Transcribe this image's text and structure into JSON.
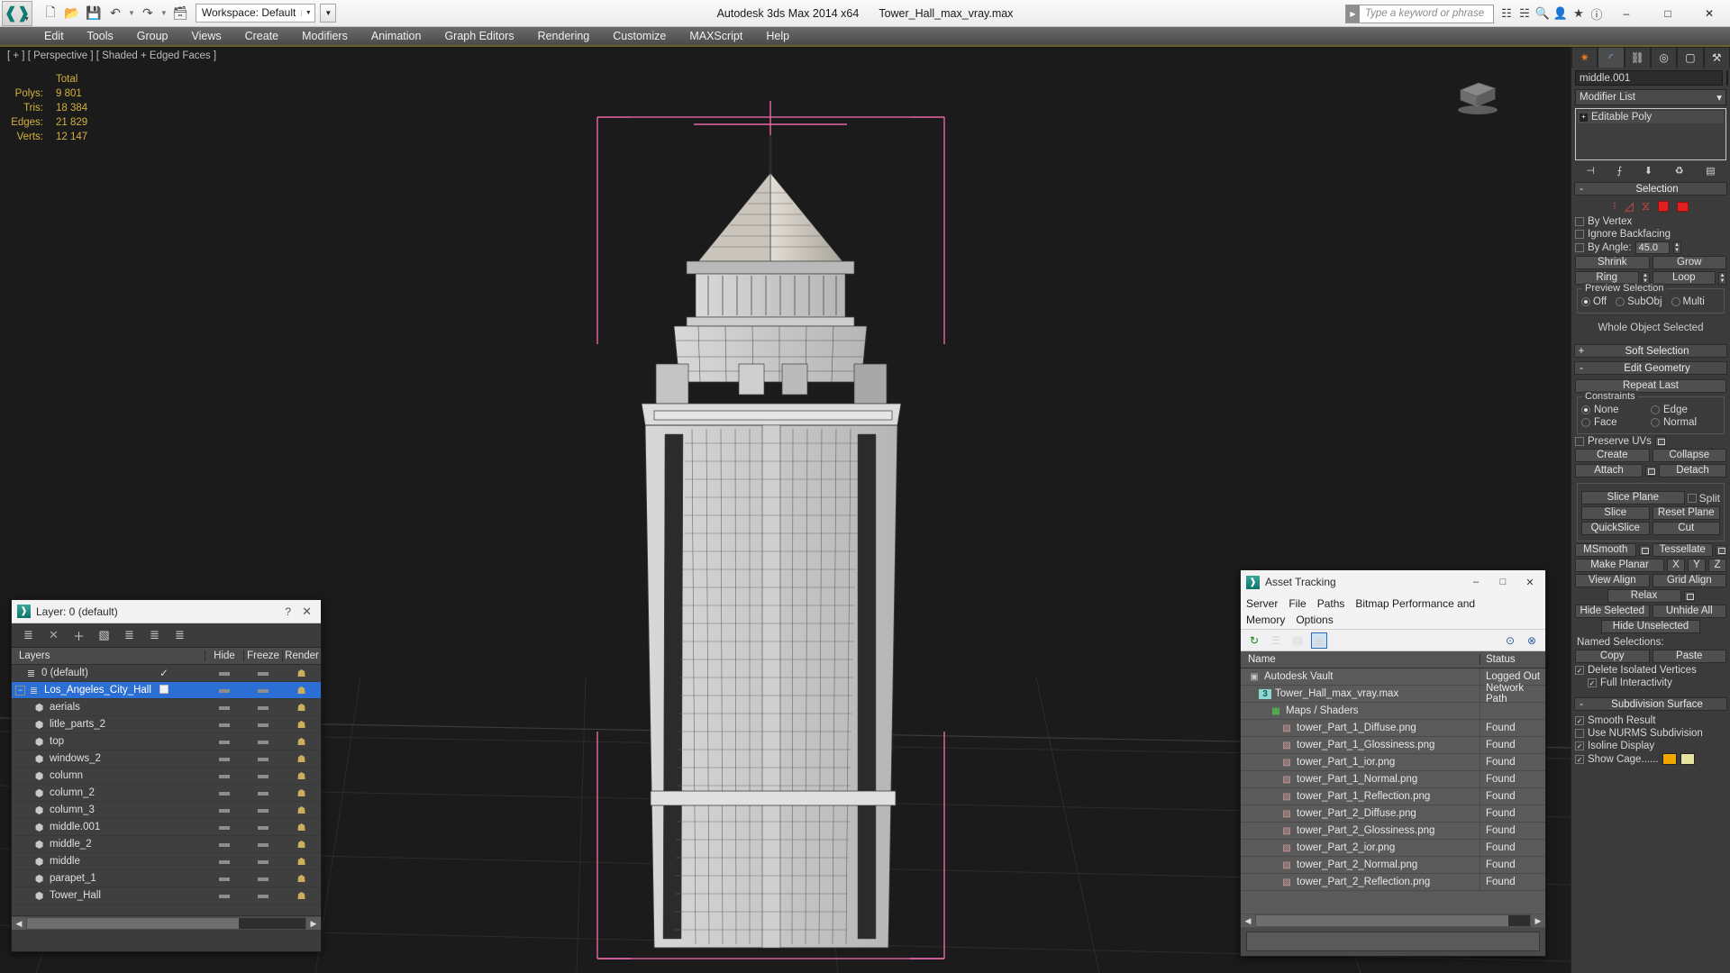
{
  "titlebar": {
    "app_logo": "max-logo-icon",
    "quick_access": [
      {
        "name": "new-scene-button",
        "icon": "new-file-icon"
      },
      {
        "name": "open-file-button",
        "icon": "open-folder-icon"
      },
      {
        "name": "save-file-button",
        "icon": "save-disk-icon"
      },
      {
        "name": "undo-button",
        "icon": "undo-arrow-icon"
      },
      {
        "name": "undo-dropdown",
        "icon": "caret-down-icon"
      },
      {
        "name": "redo-button",
        "icon": "redo-arrow-icon"
      },
      {
        "name": "redo-dropdown",
        "icon": "caret-down-icon"
      },
      {
        "name": "set-project-folder-button",
        "icon": "project-folder-icon"
      }
    ],
    "workspace_label": "Workspace: Default",
    "app_title": "Autodesk 3ds Max  2014 x64",
    "file_name": "Tower_Hall_max_vray.max",
    "search_placeholder": "Type a keyword or phrase",
    "window_buttons": {
      "minimize": "–",
      "maximize": "□",
      "close": "✕"
    }
  },
  "menubar": {
    "items": [
      "Edit",
      "Tools",
      "Group",
      "Views",
      "Create",
      "Modifiers",
      "Animation",
      "Graph Editors",
      "Rendering",
      "Customize",
      "MAXScript",
      "Help"
    ]
  },
  "viewport": {
    "label": "[ + ] [ Perspective ] [ Shaded + Edged Faces ]",
    "stats_header": "Total",
    "stats": [
      {
        "key": "Polys:",
        "value": "9 801"
      },
      {
        "key": "Tris:",
        "value": "18 384"
      },
      {
        "key": "Edges:",
        "value": "21 829"
      },
      {
        "key": "Verts:",
        "value": "12 147"
      }
    ],
    "background_color": "#1b1b1b",
    "stats_color": "#d3b13b",
    "selection_bracket_color": "#e868a8"
  },
  "layer_dialog": {
    "title": "Layer: 0 (default)",
    "help_label": "?",
    "close_label": "✕",
    "toolbar": [
      {
        "name": "create-new-layer-icon",
        "glyph": "≣"
      },
      {
        "name": "delete-layer-icon",
        "glyph": "✕"
      },
      {
        "name": "add-selection-to-layer-icon",
        "glyph": "＋"
      },
      {
        "name": "select-objects-in-layer-icon",
        "glyph": "▧"
      },
      {
        "name": "select-highlighted-objects-icon",
        "glyph": "≣"
      },
      {
        "name": "highlight-selected-objects-layers-icon",
        "glyph": "≣"
      },
      {
        "name": "layer-properties-icon",
        "glyph": "≣"
      }
    ],
    "columns": [
      "Layers",
      "",
      "Hide",
      "Freeze",
      "Render"
    ],
    "rows": [
      {
        "name": "0 (default)",
        "indent": 1,
        "selected": false,
        "expander": "",
        "current": "✓",
        "hide": "—",
        "freeze": "—",
        "render": "render-icon"
      },
      {
        "name": "Los_Angeles_City_Hall",
        "indent": 0,
        "selected": true,
        "expander": "−",
        "current": "checkbox",
        "hide": "—",
        "freeze": "—",
        "render": "render-icon"
      },
      {
        "name": "aerials",
        "indent": 2,
        "selected": false,
        "expander": "",
        "current": "",
        "hide": "—",
        "freeze": "—",
        "render": "render-icon"
      },
      {
        "name": "litle_parts_2",
        "indent": 2,
        "selected": false,
        "expander": "",
        "current": "",
        "hide": "—",
        "freeze": "—",
        "render": "render-icon"
      },
      {
        "name": "top",
        "indent": 2,
        "selected": false,
        "expander": "",
        "current": "",
        "hide": "—",
        "freeze": "—",
        "render": "render-icon"
      },
      {
        "name": "windows_2",
        "indent": 2,
        "selected": false,
        "expander": "",
        "current": "",
        "hide": "—",
        "freeze": "—",
        "render": "render-icon"
      },
      {
        "name": "column",
        "indent": 2,
        "selected": false,
        "expander": "",
        "current": "",
        "hide": "—",
        "freeze": "—",
        "render": "render-icon"
      },
      {
        "name": "column_2",
        "indent": 2,
        "selected": false,
        "expander": "",
        "current": "",
        "hide": "—",
        "freeze": "—",
        "render": "render-icon"
      },
      {
        "name": "column_3",
        "indent": 2,
        "selected": false,
        "expander": "",
        "current": "",
        "hide": "—",
        "freeze": "—",
        "render": "render-icon"
      },
      {
        "name": "middle.001",
        "indent": 2,
        "selected": false,
        "expander": "",
        "current": "",
        "hide": "—",
        "freeze": "—",
        "render": "render-icon"
      },
      {
        "name": "middle_2",
        "indent": 2,
        "selected": false,
        "expander": "",
        "current": "",
        "hide": "—",
        "freeze": "—",
        "render": "render-icon"
      },
      {
        "name": "middle",
        "indent": 2,
        "selected": false,
        "expander": "",
        "current": "",
        "hide": "—",
        "freeze": "—",
        "render": "render-icon"
      },
      {
        "name": "parapet_1",
        "indent": 2,
        "selected": false,
        "expander": "",
        "current": "",
        "hide": "—",
        "freeze": "—",
        "render": "render-icon"
      },
      {
        "name": "Tower_Hall",
        "indent": 2,
        "selected": false,
        "expander": "",
        "current": "",
        "hide": "—",
        "freeze": "—",
        "render": "render-icon"
      }
    ],
    "selected_row_color": "#2b6fd4"
  },
  "asset_tracking": {
    "title": "Asset Tracking",
    "window_buttons": {
      "minimize": "–",
      "maximize": "□",
      "close": "✕"
    },
    "menus": [
      "Server",
      "File",
      "Paths",
      "Bitmap Performance and Memory",
      "Options"
    ],
    "toolbar": [
      {
        "name": "refresh-icon",
        "glyph": "↻",
        "active": false
      },
      {
        "name": "list-view-icon",
        "glyph": "☰",
        "active": false
      },
      {
        "name": "detail-view-icon",
        "glyph": "▤",
        "active": false
      },
      {
        "name": "grid-view-icon",
        "glyph": "▦",
        "active": true
      },
      {
        "name": "check-out-icon",
        "glyph": "⊙",
        "active": false
      },
      {
        "name": "check-in-icon",
        "glyph": "⊗",
        "active": false
      }
    ],
    "columns": [
      "Name",
      "Status"
    ],
    "rows": [
      {
        "name": "Autodesk Vault",
        "status": "Logged Out",
        "indent": 0,
        "icon": "vault-icon"
      },
      {
        "name": "Tower_Hall_max_vray.max",
        "status": "Network Path",
        "indent": 1,
        "icon": "max-file-icon"
      },
      {
        "name": "Maps / Shaders",
        "status": "",
        "indent": 2,
        "icon": "maps-shaders-icon"
      },
      {
        "name": "tower_Part_1_Diffuse.png",
        "status": "Found",
        "indent": 3,
        "icon": "bitmap-icon"
      },
      {
        "name": "tower_Part_1_Glossiness.png",
        "status": "Found",
        "indent": 3,
        "icon": "bitmap-icon"
      },
      {
        "name": "tower_Part_1_ior.png",
        "status": "Found",
        "indent": 3,
        "icon": "bitmap-icon"
      },
      {
        "name": "tower_Part_1_Normal.png",
        "status": "Found",
        "indent": 3,
        "icon": "bitmap-icon"
      },
      {
        "name": "tower_Part_1_Reflection.png",
        "status": "Found",
        "indent": 3,
        "icon": "bitmap-icon"
      },
      {
        "name": "tower_Part_2_Diffuse.png",
        "status": "Found",
        "indent": 3,
        "icon": "bitmap-icon"
      },
      {
        "name": "tower_Part_2_Glossiness.png",
        "status": "Found",
        "indent": 3,
        "icon": "bitmap-icon"
      },
      {
        "name": "tower_Part_2_ior.png",
        "status": "Found",
        "indent": 3,
        "icon": "bitmap-icon"
      },
      {
        "name": "tower_Part_2_Normal.png",
        "status": "Found",
        "indent": 3,
        "icon": "bitmap-icon"
      },
      {
        "name": "tower_Part_2_Reflection.png",
        "status": "Found",
        "indent": 3,
        "icon": "bitmap-icon"
      }
    ]
  },
  "command_panel": {
    "tabs": [
      {
        "name": "create-tab",
        "icon": "star-burst-icon",
        "active": false
      },
      {
        "name": "modify-tab",
        "icon": "curve-icon",
        "active": true
      },
      {
        "name": "hierarchy-tab",
        "icon": "hierarchy-icon",
        "active": false
      },
      {
        "name": "motion-tab",
        "icon": "wheel-icon",
        "active": false
      },
      {
        "name": "display-tab",
        "icon": "monitor-icon",
        "active": false
      },
      {
        "name": "utilities-tab",
        "icon": "hammer-icon",
        "active": false
      }
    ],
    "object_name": "middle.001",
    "modifier_list_label": "Modifier List",
    "modifier_stack": [
      {
        "label": "Editable Poly"
      }
    ],
    "stack_tools": [
      {
        "name": "pin-stack-icon",
        "glyph": "⊣"
      },
      {
        "name": "show-end-result-icon",
        "glyph": "⨍"
      },
      {
        "name": "make-unique-icon",
        "glyph": "⬇"
      },
      {
        "name": "remove-modifier-icon",
        "glyph": "♻"
      },
      {
        "name": "configure-modifier-sets-icon",
        "glyph": "▤"
      }
    ],
    "rollouts": {
      "selection": {
        "title": "Selection",
        "state": "-",
        "sub_object_icons": [
          "vertex-icon",
          "edge-icon",
          "border-icon",
          "polygon-icon",
          "element-icon"
        ],
        "by_vertex": {
          "label": "By Vertex",
          "checked": false
        },
        "ignore_backfacing": {
          "label": "Ignore Backfacing",
          "checked": false
        },
        "by_angle": {
          "label": "By Angle:",
          "checked": false,
          "value": "45.0"
        },
        "shrink": "Shrink",
        "grow": "Grow",
        "ring": "Ring",
        "loop": "Loop",
        "preview_selection": {
          "label": "Preview Selection",
          "options": [
            {
              "label": "Off",
              "selected": true
            },
            {
              "label": "SubObj",
              "selected": false
            },
            {
              "label": "Multi",
              "selected": false
            }
          ]
        },
        "status": "Whole Object Selected"
      },
      "soft_selection": {
        "title": "Soft Selection",
        "state": "+"
      },
      "edit_geometry": {
        "title": "Edit Geometry",
        "state": "-",
        "repeat_last": "Repeat Last",
        "constraints": {
          "label": "Constraints",
          "options": [
            {
              "label": "None",
              "selected": true
            },
            {
              "label": "Edge",
              "selected": false
            },
            {
              "label": "Face",
              "selected": false
            },
            {
              "label": "Normal",
              "selected": false
            }
          ]
        },
        "preserve_uvs": {
          "label": "Preserve UVs",
          "checked": false
        },
        "create": "Create",
        "collapse": "Collapse",
        "attach": "Attach",
        "detach": "Detach",
        "slice_plane": "Slice Plane",
        "split": {
          "label": "Split",
          "checked": false
        },
        "slice": "Slice",
        "reset_plane": "Reset Plane",
        "quickslice": "QuickSlice",
        "cut": "Cut",
        "msmooth": "MSmooth",
        "tessellate": "Tessellate",
        "make_planar": "Make Planar",
        "axis_x": "X",
        "axis_y": "Y",
        "axis_z": "Z",
        "view_align": "View Align",
        "grid_align": "Grid Align",
        "relax": "Relax",
        "hide_selected": "Hide Selected",
        "unhide_all": "Unhide All",
        "hide_unselected": "Hide Unselected",
        "named_selections": "Named Selections:",
        "copy": "Copy",
        "paste": "Paste",
        "delete_isolated_vertices": {
          "label": "Delete Isolated Vertices",
          "checked": true
        },
        "full_interactivity": {
          "label": "Full Interactivity",
          "checked": true
        }
      },
      "subdivision_surface": {
        "title": "Subdivision Surface",
        "state": "-",
        "smooth_result": {
          "label": "Smooth Result",
          "checked": true
        },
        "use_nurms_subdivision": {
          "label": "Use NURMS Subdivision",
          "checked": false
        },
        "isoline_display": {
          "label": "Isoline Display",
          "checked": true
        },
        "show_cage": {
          "label": "Show Cage......",
          "checked": true
        },
        "cage_color_1": "#f0a800",
        "cage_color_2": "#e4e4a0"
      }
    }
  }
}
